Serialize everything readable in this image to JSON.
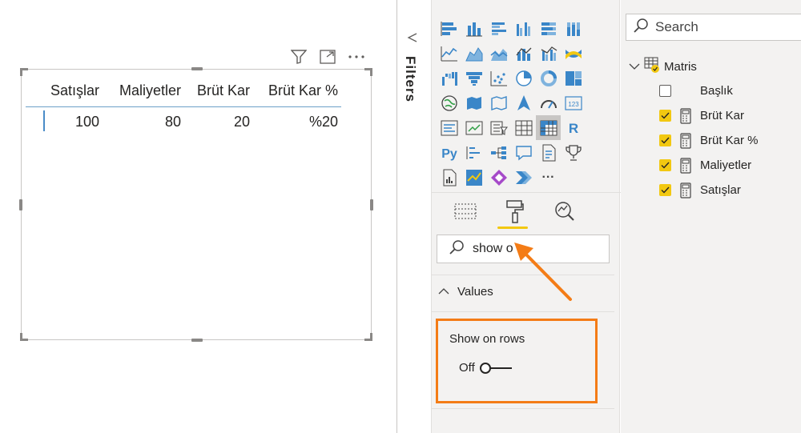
{
  "visual_header": {
    "icons": [
      "filter-icon",
      "focus-mode-icon",
      "more-options-icon"
    ]
  },
  "matrix": {
    "columns": [
      "Satışlar",
      "Maliyetler",
      "Brüt Kar",
      "Brüt Kar %"
    ],
    "rows": [
      [
        "100",
        "80",
        "20",
        "%20"
      ]
    ]
  },
  "filters_pane": {
    "label": "Filters"
  },
  "visualizations": {
    "more_label": "···",
    "tabs": [
      "fields-tab",
      "format-tab",
      "analytics-tab"
    ],
    "format_search": {
      "value": "show o"
    },
    "section": {
      "label": "Values"
    },
    "setting": {
      "label": "Show on rows",
      "state": "Off"
    },
    "highlight_color": "#f47c16"
  },
  "fields_pane": {
    "search_placeholder": "Search",
    "table": {
      "name": "Matris"
    },
    "fields": [
      {
        "label": "Başlık",
        "checked": false,
        "calc": false
      },
      {
        "label": "Brüt Kar",
        "checked": true,
        "calc": true
      },
      {
        "label": "Brüt Kar %",
        "checked": true,
        "calc": true
      },
      {
        "label": "Maliyetler",
        "checked": true,
        "calc": true
      },
      {
        "label": "Satışlar",
        "checked": true,
        "calc": true
      }
    ]
  },
  "colors": {
    "accent": "#f2c811",
    "viz_blue": "#3a86c8",
    "orange": "#f47c16"
  }
}
